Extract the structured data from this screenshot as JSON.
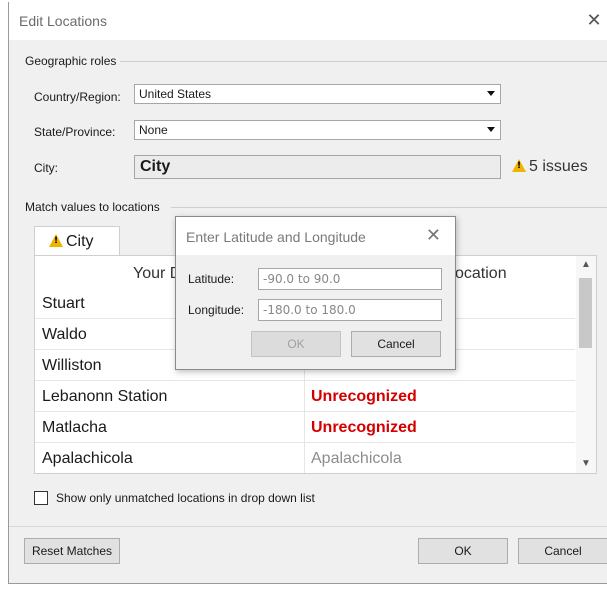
{
  "window": {
    "title": "Edit Locations"
  },
  "geographic_roles": {
    "label": "Geographic roles",
    "country_label": "Country/Region:",
    "country_value": "United States",
    "state_label": "State/Province:",
    "state_value": "None",
    "city_label": "City:",
    "city_value": "City",
    "issues_text": "5 issues"
  },
  "match": {
    "label": "Match values to locations",
    "tab_label": "City",
    "col_your_data": "Your D",
    "col_location": "ocation",
    "rows": [
      {
        "value": "Stuart",
        "match": ""
      },
      {
        "value": "Waldo",
        "match": ""
      },
      {
        "value": "Williston",
        "match": ""
      },
      {
        "value": "Lebanonn Station",
        "match": "Unrecognized"
      },
      {
        "value": "Matlacha",
        "match": "Unrecognized"
      },
      {
        "value": "Apalachicola",
        "match": "Apalachicola"
      }
    ]
  },
  "show_unmatched_label": "Show only unmatched locations in drop down list",
  "buttons": {
    "reset": "Reset Matches",
    "ok": "OK",
    "cancel": "Cancel"
  },
  "popup": {
    "title": "Enter Latitude and Longitude",
    "lat_label": "Latitude:",
    "lat_placeholder": "-90.0 to 90.0",
    "lon_label": "Longitude:",
    "lon_placeholder": "-180.0 to 180.0",
    "ok": "OK",
    "cancel": "Cancel"
  },
  "colors": {
    "unrecognized": "#d40000",
    "warning": "#f0b400"
  }
}
